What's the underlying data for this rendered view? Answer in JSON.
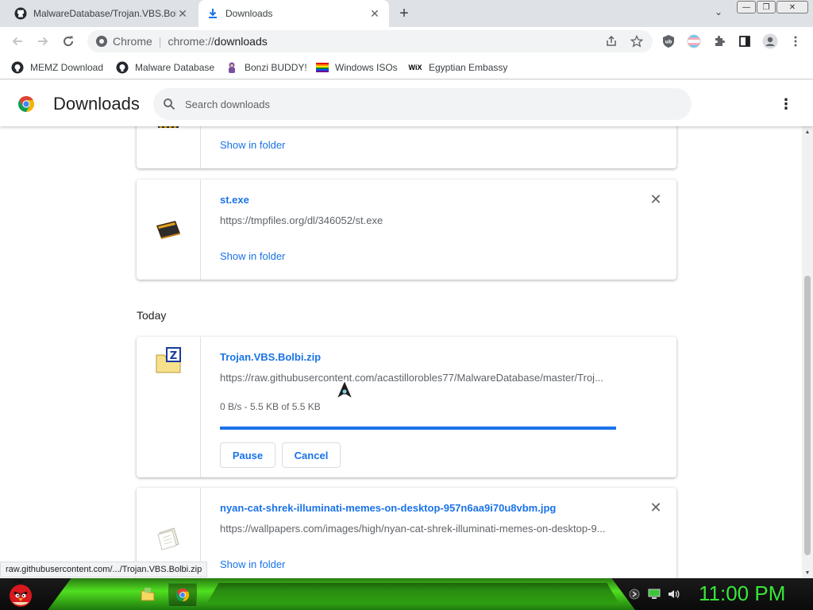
{
  "tabs": [
    {
      "title": "MalwareDatabase/Trojan.VBS.Bolbi",
      "close": "✕"
    },
    {
      "title": "Downloads",
      "close": "✕"
    }
  ],
  "tabstrip": {
    "new_tab": "+",
    "tab_search": "⌄"
  },
  "window_controls": {
    "minimize": "—",
    "restore": "❐",
    "close": "✕"
  },
  "omnibox": {
    "site_label": "Chrome",
    "separator": "|",
    "scheme": "chrome://",
    "path": "downloads"
  },
  "bookmarks": [
    {
      "label": "MEMZ Download",
      "icon": "github-icon"
    },
    {
      "label": "Malware Database",
      "icon": "github-icon"
    },
    {
      "label": "Bonzi BUDDY!",
      "icon": "bonzi-icon"
    },
    {
      "label": "Windows ISOs",
      "icon": "windows-flag-icon"
    },
    {
      "label": "Egyptian Embassy",
      "icon": "wix-icon"
    }
  ],
  "bookmark_wix_text": "WiX",
  "header": {
    "title": "Downloads",
    "search_placeholder": "Search downloads",
    "menu": "⋮"
  },
  "downloads": {
    "partial_item": {
      "show_in_folder": "Show in folder"
    },
    "st_item": {
      "filename": "st.exe",
      "url": "https://tmpfiles.org/dl/346052/st.exe",
      "show_in_folder": "Show in folder",
      "remove": "✕"
    },
    "section_label": "Today",
    "trojan_item": {
      "filename": "Trojan.VBS.Bolbi.zip",
      "url": "https://raw.githubusercontent.com/acastillorobles77/MalwareDatabase/master/Troj...",
      "status": "0 B/s - 5.5 KB of 5.5 KB",
      "progress_fraction": 1.0,
      "pause_label": "Pause",
      "cancel_label": "Cancel"
    },
    "nyan_item": {
      "filename": "nyan-cat-shrek-illuminati-memes-on-desktop-957n6aa9i70u8vbm.jpg",
      "url": "https://wallpapers.com/images/high/nyan-cat-shrek-illuminati-memes-on-desktop-9...",
      "show_in_folder": "Show in folder",
      "remove": "✕"
    }
  },
  "status_bar": {
    "link": "raw.githubusercontent.com/.../Trojan.VBS.Bolbi.zip"
  },
  "taskbar": {
    "clock": "11:00 PM"
  },
  "colors": {
    "accent": "#1a73e8",
    "clock_green": "#39e639",
    "taskbar_green": "#50e020"
  }
}
